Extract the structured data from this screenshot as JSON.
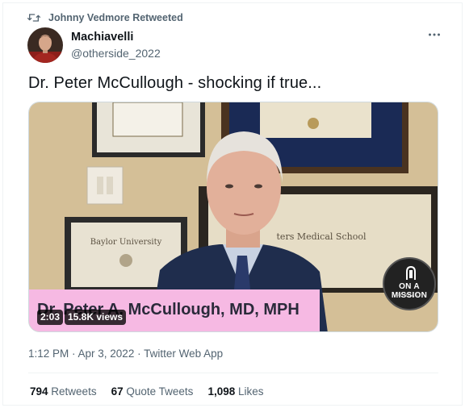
{
  "retweet_context": {
    "text": "Johnny Vedmore Retweeted",
    "icon": "retweet-icon"
  },
  "author": {
    "name": "Machiavelli",
    "handle": "@otherside_2022",
    "avatar": "avatar-portrait"
  },
  "tweet": {
    "text": "Dr. Peter McCullough - shocking if true..."
  },
  "media": {
    "caption": "Dr. Peter A. McCullough, MD, MPH",
    "duration": "2:03",
    "views": "15.8K views",
    "logo": {
      "title": "ON A MISSION",
      "subtitle": "PODCAST"
    },
    "diploma_text": "Baylor University",
    "diploma_text_right": "ters Medical School"
  },
  "meta": {
    "timestamp": "1:12 PM · Apr 3, 2022 · Twitter Web App"
  },
  "stats": [
    {
      "count": "794",
      "label": "Retweets"
    },
    {
      "count": "67",
      "label": "Quote Tweets"
    },
    {
      "count": "1,098",
      "label": "Likes"
    }
  ],
  "colors": {
    "text_primary": "#0f1419",
    "text_secondary": "#536471",
    "caption_bar": "#f6b9e3",
    "suit": "#1f2d4d"
  }
}
